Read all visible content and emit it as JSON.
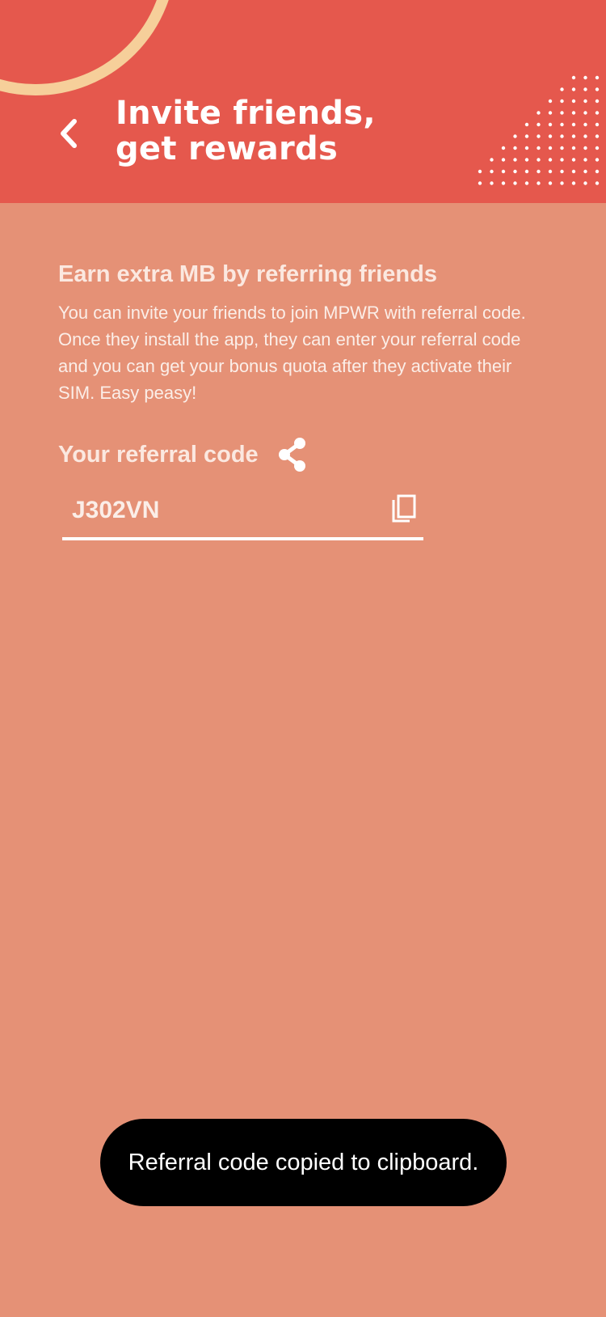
{
  "header": {
    "title_line1": "Invite friends,",
    "title_line2": "get rewards",
    "back_icon": "chevron-left-icon",
    "colors": {
      "background": "#e5584d",
      "ring": "#f6cf9a",
      "dots": "#ffffff"
    }
  },
  "main": {
    "heading": "Earn extra MB by referring friends",
    "description": "You can invite your friends to join MPWR with referral code. Once they install the app, they can enter your referral code and you can get your bonus quota after they activate their SIM. Easy peasy!",
    "referral_label": "Your referral code",
    "share_icon": "share-icon",
    "referral_code": "J302VN",
    "copy_icon": "copy-icon",
    "background": "#e59176"
  },
  "toast": {
    "message": "Referral code copied to clipboard."
  }
}
